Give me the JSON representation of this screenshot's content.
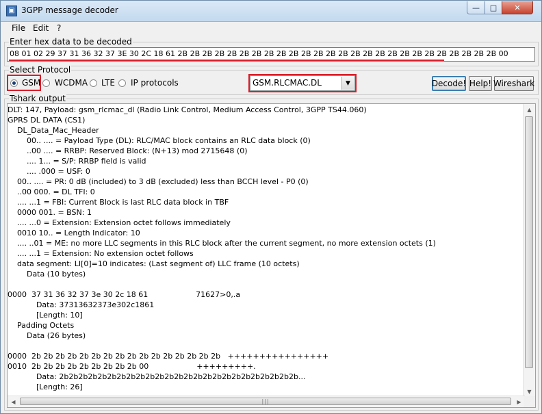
{
  "window": {
    "title": "3GPP message decoder"
  },
  "titlebar_buttons": {
    "minimize": "—",
    "maximize": "□",
    "close": "✕"
  },
  "menu": [
    "File",
    "Edit",
    "?"
  ],
  "hex_group": {
    "label": "Enter hex data to be decoded",
    "value": "08 01 02 29 37 31 36 32 37 3E 30 2C 18 61 2B 2B 2B 2B 2B 2B 2B 2B 2B 2B 2B 2B 2B 2B 2B 2B 2B 2B 2B 2B 2B 2B 2B 2B 2B 2B 00"
  },
  "protocol_group": {
    "label": "Select Protocol",
    "options": [
      "GSM",
      "WCDMA",
      "LTE",
      "IP protocols"
    ],
    "selected": "GSM",
    "dropdown_value": "GSM.RLCMAC.DL",
    "dropdown_arrow": "▼"
  },
  "buttons": {
    "decode": "Decode!",
    "help": "Help!",
    "wireshark": "Wireshark"
  },
  "output_group": {
    "label": "Tshark output",
    "lines": [
      "DLT: 147, Payload: gsm_rlcmac_dl (Radio Link Control, Medium Access Control, 3GPP TS44.060)",
      "GPRS DL DATA (CS1)",
      "    DL_Data_Mac_Header",
      "        00.. .... = Payload Type (DL): RLC/MAC block contains an RLC data block (0)",
      "        ..00 .... = RRBP: Reserved Block: (N+13) mod 2715648 (0)",
      "        .... 1... = S/P: RRBP field is valid",
      "        .... .000 = USF: 0",
      "    00.. .... = PR: 0 dB (included) to 3 dB (excluded) less than BCCH level - P0 (0)",
      "    ..00 000. = DL TFI: 0",
      "    .... ...1 = FBI: Current Block is last RLC data block in TBF",
      "    0000 001. = BSN: 1",
      "    .... ...0 = Extension: Extension octet follows immediately",
      "    0010 10.. = Length Indicator: 10",
      "    .... ..01 = ME: no more LLC segments in this RLC block after the current segment, no more extension octets (1)",
      "    .... ...1 = Extension: No extension octet follows",
      "    data segment: LI[0]=10 indicates: (Last segment of) LLC frame (10 octets)",
      "        Data (10 bytes)",
      "",
      "0000  37 31 36 32 37 3e 30 2c 18 61                    71627>0,.a",
      "            Data: 37313632373e302c1861",
      "            [Length: 10]",
      "    Padding Octets",
      "        Data (26 bytes)",
      "",
      "0000  2b 2b 2b 2b 2b 2b 2b 2b 2b 2b 2b 2b 2b 2b 2b 2b   ++++++++++++++++",
      "0010  2b 2b 2b 2b 2b 2b 2b 2b 2b 00                    +++++++++.",
      "            Data: 2b2b2b2b2b2b2b2b2b2b2b2b2b2b2b2b2b2b2b2b2b2b2b2b2b...",
      "            [Length: 26]"
    ]
  },
  "scroll_glyphs": {
    "up": "▲",
    "down": "▼",
    "left": "◀",
    "right": "▶",
    "grip": "|||"
  },
  "colors": {
    "highlight_red": "#d81e2a",
    "title_bg": "#c3d9ef"
  }
}
